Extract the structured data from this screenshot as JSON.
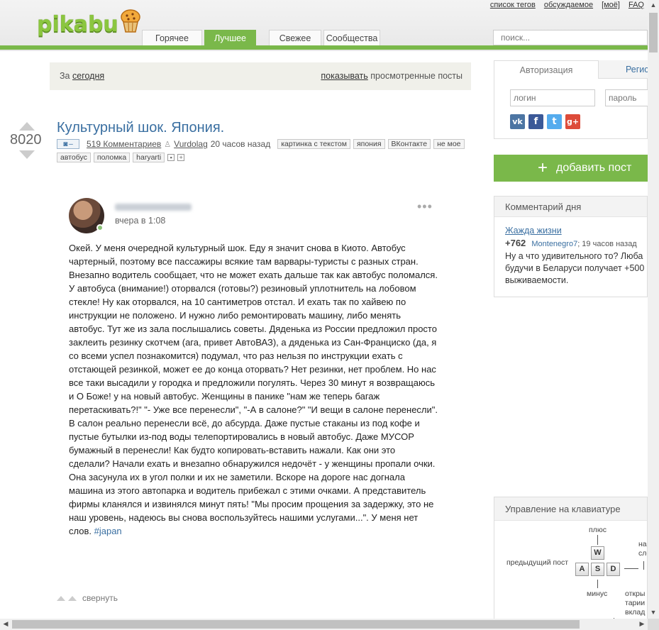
{
  "header": {
    "logo_text": "pikabu",
    "toplinks": [
      "список тегов",
      "обсуждаемое",
      "[моё]",
      "FAQ"
    ],
    "nav": [
      {
        "label": "Горячее",
        "active": false
      },
      {
        "label": "Лучшее",
        "active": true
      },
      {
        "label": "Свежее",
        "active": false
      },
      {
        "label": "Сообщества",
        "active": false
      }
    ],
    "search_placeholder": "поиск..."
  },
  "filter": {
    "prefix": "За",
    "period": "сегодня",
    "show_link": "показывать",
    "show_suffix": "просмотренные посты"
  },
  "post": {
    "rating": "8020",
    "title": "Культурный шок. Япония.",
    "cam_dash": "–",
    "comments": "519 Комментариев",
    "author": "Vurdolag",
    "time": "20 часов назад",
    "tags_row1": [
      "картинка с текстом",
      "япония",
      "ВКонтакте",
      "не мое"
    ],
    "tags_row2": [
      "автобус",
      "поломка",
      "haryarti"
    ],
    "collapse_label": "свернуть"
  },
  "card": {
    "time": "вчера в 1:08",
    "more": "•••",
    "text": "Окей. У меня очередной культурный шок. Еду я значит снова в Киото. Автобус чартерный, поэтому все пассажиры всякие там варвары-туристы с разных стран. Внезапно водитель сообщает, что не может ехать дальше так как автобус поломался. У автобуса (внимание!) оторвался (готовы?) резиновый уплотнитель на лобовом стекле! Ну как оторвался, на 10 сантиметров отстал. И ехать так по хайвею по инструкции не положено. И нужно либо ремонтировать машину, либо менять автобус. Тут же из зала послышались советы. Дяденька из России предложил просто заклеить резинку скотчем (ага, привет АвтоВАЗ), а дяденька из Сан-Франциско (да, я со всеми успел познакомится) подумал, что раз нельзя по инструкции ехать с отстающей резинкой, может ее до конца оторвать? Нет резинки, нет проблем. Но нас все таки высадили у городка и предложили погулять. Через 30 минут я возвращаюсь и О Боже! у на новый автобус. Женщины в панике \"нам же теперь багаж перетаскивать?!\" \"- Уже все перенесли\", \"-А в салоне?\" \"И вещи в салоне перенесли\". В салон реально перенесли всё, до абсурда. Даже пустые стаканы из под кофе и пустые бутылки из-под воды телепортировались в новый автобус. Даже МУСОР бумажный в перенесли! Как будто копировать-вставить нажали. Как они это сделали? Начали ехать и внезапно обнаружился недочёт - у женщины пропали очки. Она засунула их в угол полки и их не заметили. Вскоре на дороге нас догнала машина из этого автопарка и водитель прибежал с этими очками. А представитель фирмы кланялся и извинялся минут пять! \"Мы просим прощения за задержку, это не наш уровень, надеюсь вы снова воспользуйтесь нашими услугами...\". У меня нет слов.",
    "hashtag": "#japan"
  },
  "sidebar": {
    "auth_tab": "Авторизация",
    "reg_tab": "Регистрация",
    "login_placeholder": "логин",
    "password_placeholder": "пароль",
    "social": [
      {
        "name": "vk",
        "glyph": "vk",
        "color": "#4c75a3"
      },
      {
        "name": "facebook",
        "glyph": "f",
        "color": "#3b5998"
      },
      {
        "name": "twitter",
        "glyph": "t",
        "color": "#55acee"
      },
      {
        "name": "google-plus",
        "glyph": "g+",
        "color": "#dd4b39"
      }
    ],
    "add_post": "добавить пост",
    "cotd": {
      "title": "Комментарий дня",
      "post_link": "Жажда жизни",
      "rating": "+762",
      "nick": "Montenegro7",
      "time": "; 19 часов назад",
      "text_lines": [
        "Ну а что удивительного то? Люба",
        "будучи в Беларуси получает +500",
        "выживаемости."
      ]
    },
    "keyboard": {
      "title": "Управление на клавиатуре",
      "plus": "плюс",
      "minus": "минус",
      "prev": "предыдущий пост",
      "next_line1": "начало",
      "next_line2": "следую",
      "open_line1": "откры",
      "open_line2": "тарии",
      "open_line3": "вклад",
      "keys": [
        "W",
        "A",
        "S",
        "D"
      ]
    }
  }
}
